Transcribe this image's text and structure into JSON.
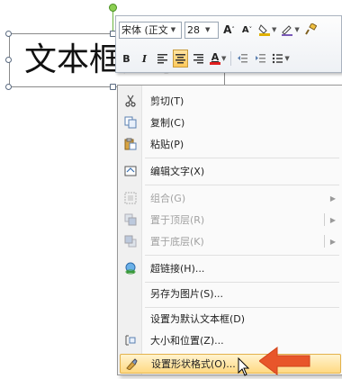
{
  "textbox": {
    "text": "文本框文字"
  },
  "mini_toolbar": {
    "font_name": "宋体 (正文",
    "font_size": "28",
    "grow_font": "A",
    "shrink_font": "A",
    "bold": "B",
    "italic": "I",
    "font_color_letter": "A"
  },
  "menu": {
    "items": [
      {
        "label": "剪切(T)",
        "icon": "scissors-icon"
      },
      {
        "label": "复制(C)",
        "icon": "copy-icon"
      },
      {
        "label": "粘贴(P)",
        "icon": "paste-icon"
      },
      {
        "label": "编辑文字(X)",
        "icon": "edit-text-icon"
      },
      {
        "label": "组合(G)",
        "icon": "group-icon",
        "disabled": true,
        "submenu": true
      },
      {
        "label": "置于顶层(R)",
        "icon": "bring-to-front-icon",
        "disabled": true,
        "submenu": true,
        "split": true
      },
      {
        "label": "置于底层(K)",
        "icon": "send-to-back-icon",
        "disabled": true,
        "submenu": true,
        "split": true
      },
      {
        "label": "超链接(H)...",
        "icon": "hyperlink-icon"
      },
      {
        "label": "另存为图片(S)...",
        "icon": ""
      },
      {
        "label": "设置为默认文本框(D)",
        "icon": ""
      },
      {
        "label": "大小和位置(Z)...",
        "icon": "size-position-icon"
      },
      {
        "label": "设置形状格式(O)...",
        "icon": "format-shape-icon",
        "highlighted": true
      }
    ]
  },
  "colors": {
    "highlight_fill": "#ffd982",
    "pointer_arrow": "#e8562a",
    "rotate_handle": "#8ccf52"
  }
}
